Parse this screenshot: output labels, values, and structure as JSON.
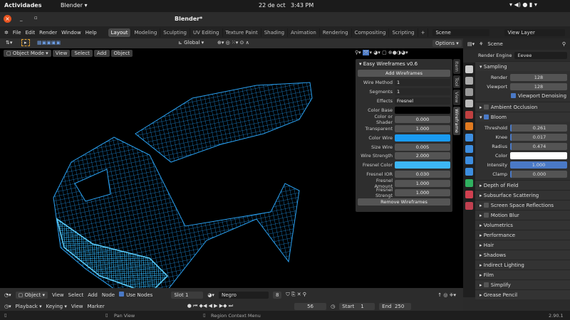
{
  "gnome": {
    "activities": "Actividades",
    "app": "Blender ▾",
    "date": "22 de oct",
    "time": "3:43 PM"
  },
  "window": {
    "title": "Blender*"
  },
  "menu": {
    "items": [
      "File",
      "Edit",
      "Render",
      "Window",
      "Help"
    ],
    "workspaces": [
      "Layout",
      "Modeling",
      "Sculpting",
      "UV Editing",
      "Texture Paint",
      "Shading",
      "Animation",
      "Rendering",
      "Compositing",
      "Scripting"
    ],
    "scene": "Scene",
    "view_layer": "View Layer"
  },
  "viewport": {
    "orientation": "Global",
    "options": "Options",
    "mode": "Object Mode",
    "menus": [
      "View",
      "Select",
      "Add",
      "Object"
    ]
  },
  "npanel": {
    "title": "Easy Wireframes v0.6",
    "add": "Add Wireframes",
    "remove": "Remove Wireframes",
    "rows": [
      {
        "label": "Wire Method",
        "value": "1",
        "type": "select"
      },
      {
        "label": "Segments",
        "value": "1",
        "type": "select"
      },
      {
        "label": "Effects",
        "value": "Fresnel",
        "type": "select"
      },
      {
        "label": "Color Base",
        "color": "#000000"
      },
      {
        "label": "Color or Shader",
        "value": "0.000"
      },
      {
        "label": "Transparent",
        "value": "1.000"
      },
      {
        "label": "Color Wire",
        "color": "#1a9bf2"
      },
      {
        "label": "Size Wire",
        "value": "0.005"
      },
      {
        "label": "Wire Strength",
        "value": "2.000"
      },
      {
        "label": "Fresnel Color",
        "color": "#3db6f5"
      },
      {
        "label": "Fresnel IOR",
        "value": "0.030"
      },
      {
        "label": "Fresnel Amount",
        "value": "1.000"
      },
      {
        "label": "Fresnel Strengt",
        "value": "1.000"
      }
    ],
    "tabs": [
      "Item",
      "Tool",
      "View",
      "Wireframe"
    ]
  },
  "props": {
    "scene": "Scene",
    "render_engine_label": "Render Engine",
    "render_engine": "Eevee",
    "sampling": {
      "title": "Sampling",
      "render_label": "Render",
      "render": "128",
      "viewport_label": "Viewport",
      "viewport": "128",
      "denoise": "Viewport Denoising"
    },
    "ao": "Ambient Occlusion",
    "bloom": {
      "title": "Bloom",
      "rows": [
        {
          "label": "Threshold",
          "value": "0.261"
        },
        {
          "label": "Knee",
          "value": "0.017"
        },
        {
          "label": "Radius",
          "value": "0.474"
        },
        {
          "label": "Color",
          "color": "#ffffff"
        },
        {
          "label": "Intensity",
          "value": "1.000"
        },
        {
          "label": "Clamp",
          "value": "0.000"
        }
      ]
    },
    "sections": [
      {
        "label": "Depth of Field"
      },
      {
        "label": "Subsurface Scattering"
      },
      {
        "label": "Screen Space Reflections",
        "check": true
      },
      {
        "label": "Motion Blur",
        "check": true
      },
      {
        "label": "Volumetrics"
      },
      {
        "label": "Performance"
      },
      {
        "label": "Hair"
      },
      {
        "label": "Shadows"
      },
      {
        "label": "Indirect Lighting"
      },
      {
        "label": "Film"
      },
      {
        "label": "Simplify",
        "check": true
      },
      {
        "label": "Grease Pencil"
      }
    ]
  },
  "shader": {
    "object": "Object",
    "menus": [
      "View",
      "Select",
      "Add",
      "Node"
    ],
    "use_nodes": "Use Nodes",
    "slot": "Slot 1",
    "material": "Negro",
    "users": "8"
  },
  "timeline": {
    "menus": [
      "Playback ▾",
      "Keying ▾",
      "View",
      "Marker"
    ],
    "frame": "56",
    "start_label": "Start",
    "start": "1",
    "end_label": "End",
    "end": "250"
  },
  "status": {
    "pan": "Pan View",
    "context": "Region Context Menu",
    "version": "2.90.1"
  }
}
